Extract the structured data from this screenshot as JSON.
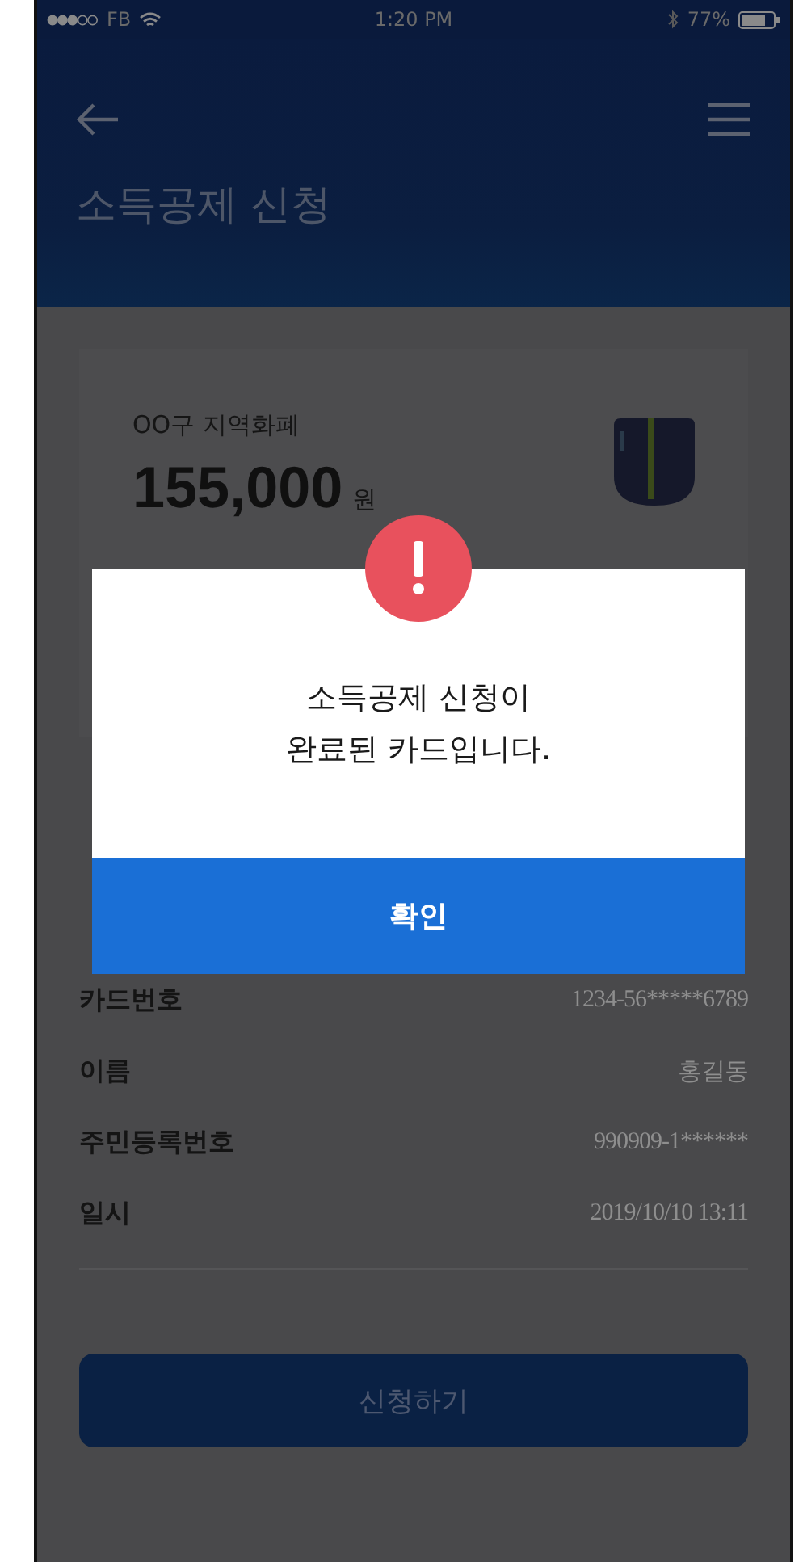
{
  "status_bar": {
    "carrier": "FB",
    "time": "1:20 PM",
    "battery": "77%"
  },
  "header": {
    "title": "소득공제 신청"
  },
  "card": {
    "name": "OO구 지역화폐",
    "amount": "155,000",
    "unit": "원"
  },
  "details": [
    {
      "label": "카드번호",
      "value": "1234-56*****6789"
    },
    {
      "label": "이름",
      "value": "홍길동"
    },
    {
      "label": "주민등록번호",
      "value": "990909-1******"
    },
    {
      "label": "일시",
      "value": "2019/10/10 13:11"
    }
  ],
  "submit_button": "신청하기",
  "dialog": {
    "message": "소득공제 신청이\n완료된 카드입니다.",
    "confirm_button": "확인"
  }
}
